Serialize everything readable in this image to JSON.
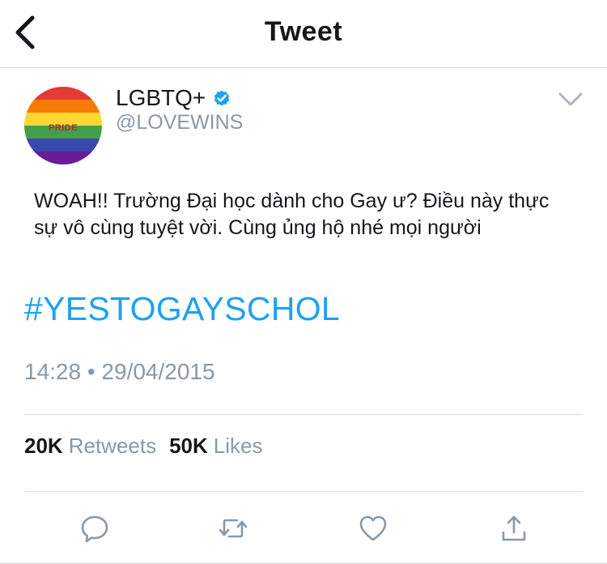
{
  "header": {
    "title": "Tweet",
    "back_icon": "chevron-left-icon"
  },
  "author": {
    "display_name": "LGBTQ+",
    "handle": "@LOVEWINS",
    "verified_icon": "verified-badge-icon",
    "avatar_text": "PRIDE",
    "avatar_colors": [
      "#e53935",
      "#f57c00",
      "#fdd835",
      "#43a047",
      "#3949ab",
      "#6a1b9a"
    ]
  },
  "tweet": {
    "text": "WOAH!! Trường Đại học dành cho Gay ư? Điều này thực sự vô cùng tuyệt vời. Cùng ủng hộ nhé mọi người",
    "hashtag": "#YESTOGAYSCHOL",
    "timestamp": "14:28 • 29/04/2015"
  },
  "stats": {
    "retweets_count": "20K",
    "retweets_label": "Retweets",
    "likes_count": "50K",
    "likes_label": "Likes"
  },
  "actions": [
    "reply-icon",
    "retweet-icon",
    "like-icon",
    "share-icon"
  ],
  "colors": {
    "accent": "#1da1f2",
    "muted": "#8899a6",
    "text": "#14171a"
  }
}
